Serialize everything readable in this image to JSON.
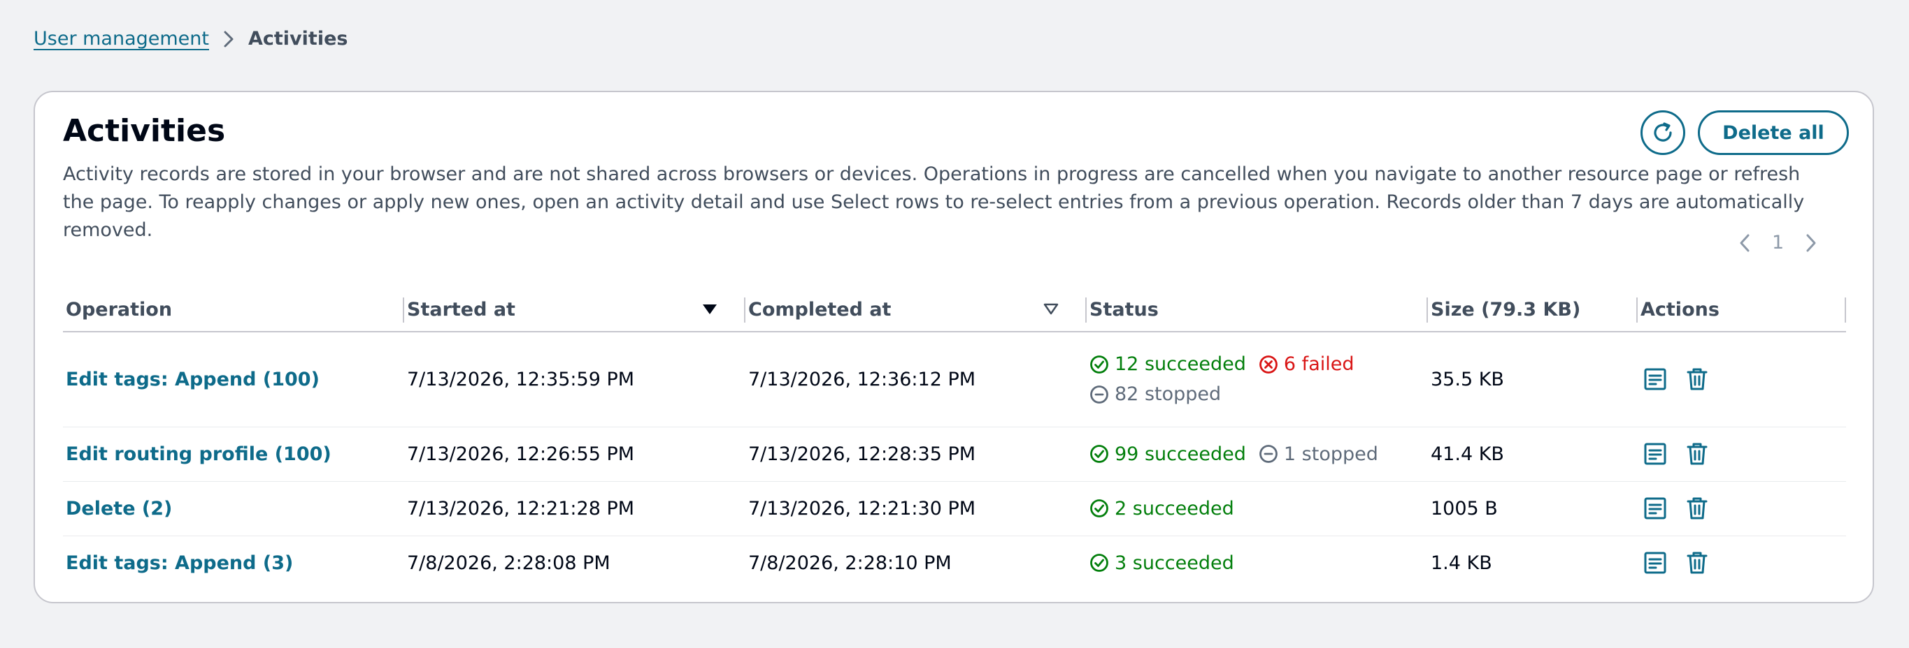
{
  "breadcrumb": {
    "parent": "User management",
    "current": "Activities"
  },
  "card": {
    "title": "Activities",
    "description": "Activity records are stored in your browser and are not shared across browsers or devices. Operations in progress are cancelled when you navigate to another resource page or refresh the page. To reapply changes or apply new ones, open an activity detail and use Select rows to re-select entries from a previous operation. Records older than 7 days are automatically removed.",
    "delete_all_label": "Delete all",
    "refresh_icon": "refresh-icon"
  },
  "pagination": {
    "current_page": "1"
  },
  "table": {
    "columns": {
      "operation": "Operation",
      "started_at": "Started at",
      "completed_at": "Completed at",
      "status": "Status",
      "size": "Size (79.3 KB)",
      "actions": "Actions"
    },
    "sort": {
      "started_at": "descending-active",
      "completed_at": "inactive"
    },
    "rows": [
      {
        "operation": "Edit tags: Append (100)",
        "started_at": "7/13/2026, 12:35:59 PM",
        "completed_at": "7/13/2026, 12:36:12 PM",
        "status": [
          {
            "type": "ok",
            "text": "12 succeeded"
          },
          {
            "type": "fail",
            "text": "6 failed"
          },
          {
            "type": "stop",
            "text": "82 stopped"
          }
        ],
        "size": "35.5 KB"
      },
      {
        "operation": "Edit routing profile (100)",
        "started_at": "7/13/2026, 12:26:55 PM",
        "completed_at": "7/13/2026, 12:28:35 PM",
        "status": [
          {
            "type": "ok",
            "text": "99 succeeded"
          },
          {
            "type": "stop",
            "text": "1 stopped"
          }
        ],
        "size": "41.4 KB"
      },
      {
        "operation": "Delete (2)",
        "started_at": "7/13/2026, 12:21:28 PM",
        "completed_at": "7/13/2026, 12:21:30 PM",
        "status": [
          {
            "type": "ok",
            "text": "2 succeeded"
          }
        ],
        "size": "1005 B"
      },
      {
        "operation": "Edit tags: Append (3)",
        "started_at": "7/8/2026, 2:28:08 PM",
        "completed_at": "7/8/2026, 2:28:10 PM",
        "status": [
          {
            "type": "ok",
            "text": "3 succeeded"
          }
        ],
        "size": "1.4 KB"
      }
    ]
  },
  "colors": {
    "link": "#0e6b8a",
    "success": "#037f0c",
    "error": "#d91515",
    "stopped": "#5f6b7a",
    "background": "#f1f2f4"
  }
}
